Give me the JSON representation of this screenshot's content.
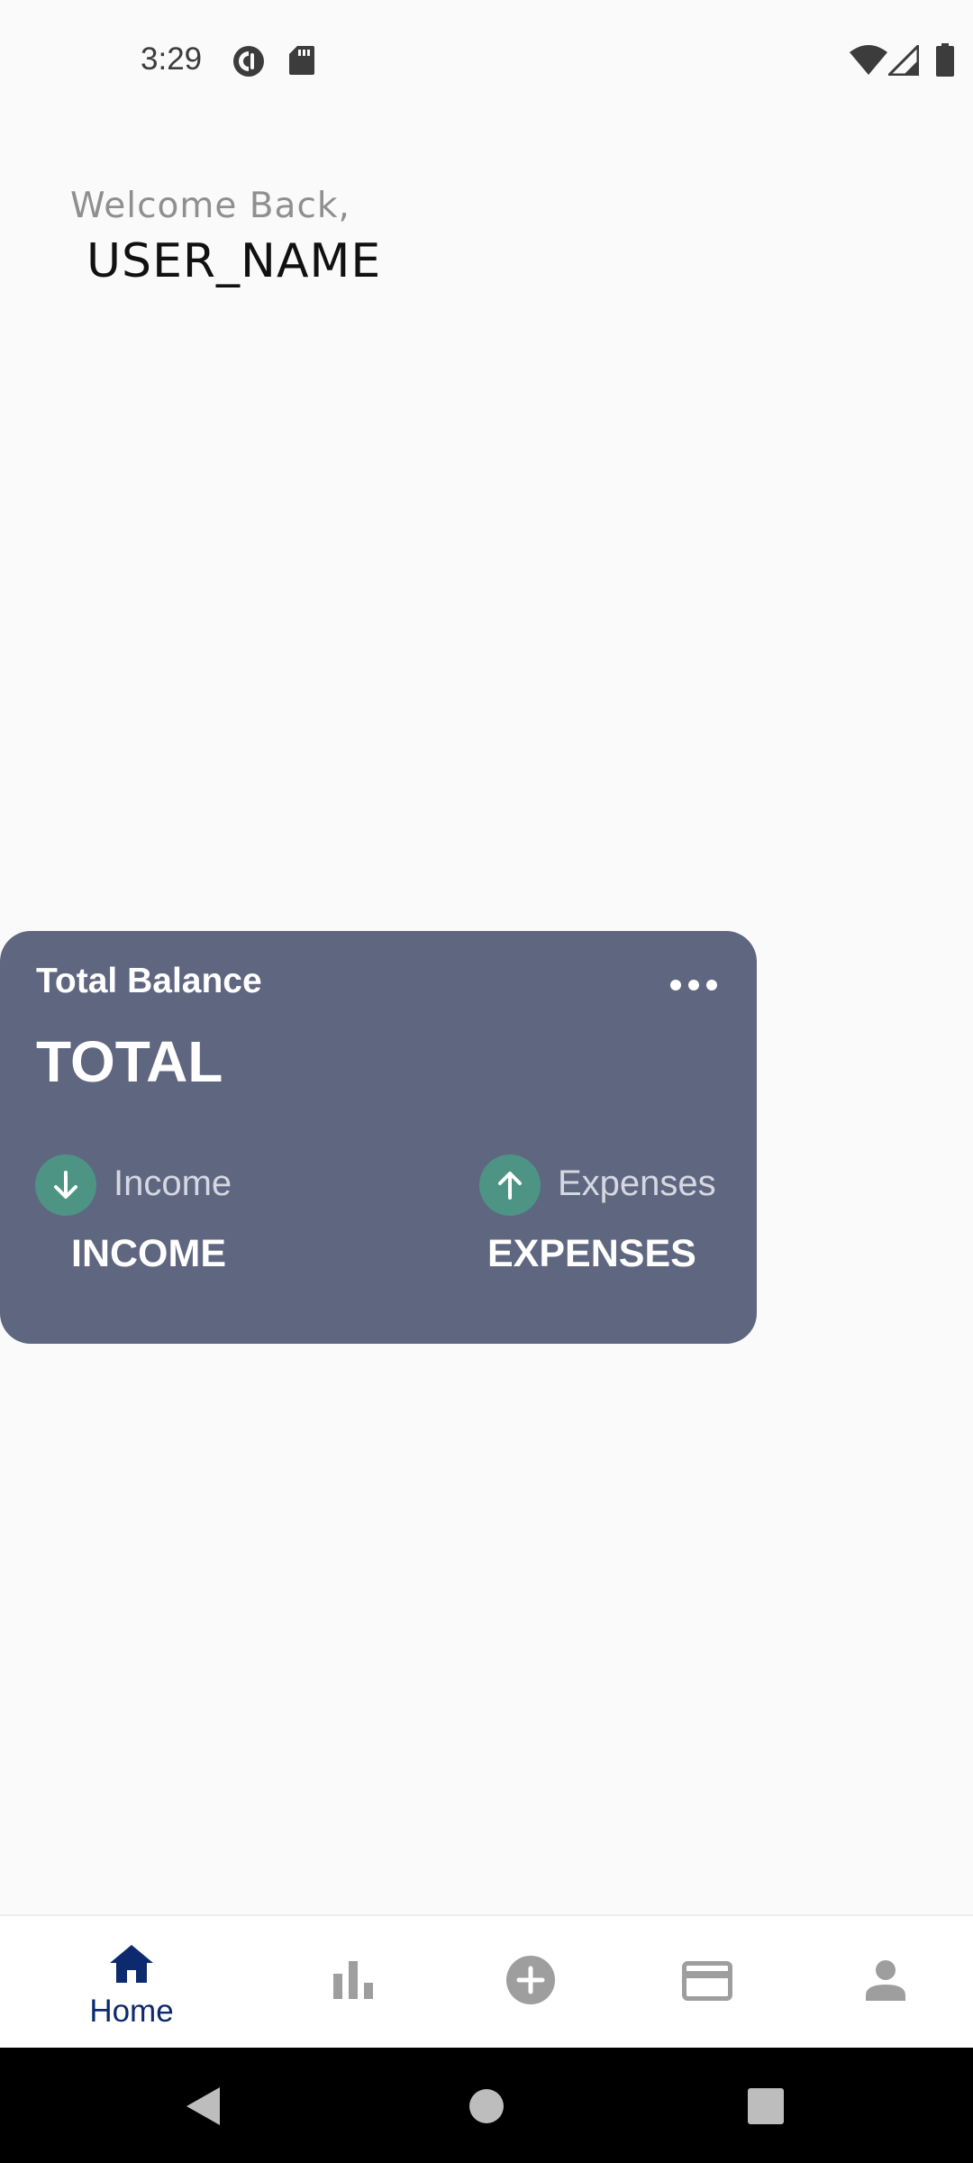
{
  "status_bar": {
    "time": "3:29",
    "icons": [
      "pocket-casts-icon",
      "sd-card-icon",
      "wifi-icon",
      "cell-signal-icon",
      "battery-icon"
    ]
  },
  "header": {
    "welcome": "Welcome Back,",
    "username": "USER_NAME"
  },
  "balance_card": {
    "title": "Total Balance",
    "total": "TOTAL",
    "income_label": "Income",
    "income_value": "INCOME",
    "expenses_label": "Expenses",
    "expenses_value": "EXPENSES",
    "menu_icon": "more-horiz-icon",
    "colors": {
      "card_bg": "#5f6680",
      "icon_circle": "#4e9485"
    }
  },
  "bottom_nav": {
    "active": "Home",
    "items": [
      {
        "label": "Home",
        "icon": "home-icon"
      },
      {
        "icon": "bar-chart-icon"
      },
      {
        "icon": "add-circle-icon"
      },
      {
        "icon": "credit-card-icon"
      },
      {
        "icon": "person-icon"
      }
    ],
    "colors": {
      "active": "#0d2a6e",
      "inactive": "#9e9e9e"
    }
  },
  "system_nav": {
    "icons": [
      "back-icon",
      "home-circle-icon",
      "recents-icon"
    ]
  }
}
